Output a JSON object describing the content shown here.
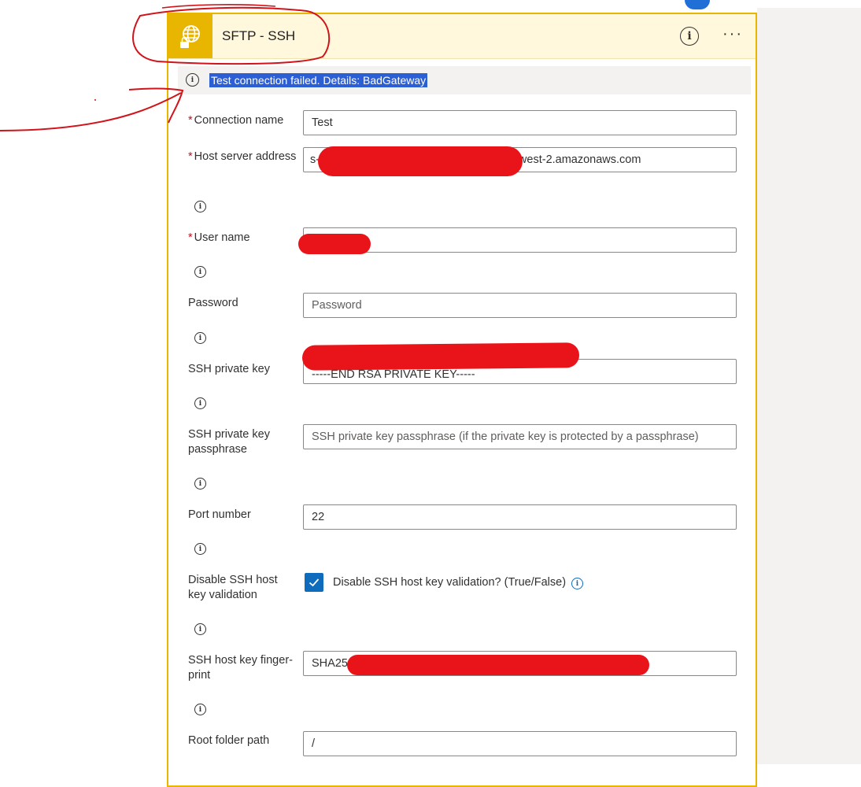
{
  "connector": {
    "title": "SFTP - SSH",
    "icon": "globe-lock-icon",
    "brand_color": "#e8b500"
  },
  "header": {
    "info_icon": "info-icon",
    "more_icon": "more-options-icon"
  },
  "alert": {
    "message": "Test connection failed. Details: BadGateway"
  },
  "form": {
    "connection_name": {
      "label": "Connection name",
      "required": true,
      "value": "Test"
    },
    "host_server_address": {
      "label": "Host server address",
      "required": true,
      "value": "s-",
      "value_suffix": "-west-2.amazonaws.com"
    },
    "user_name": {
      "label": "User name",
      "required": true,
      "value": ""
    },
    "password": {
      "label": "Password",
      "placeholder": "Password"
    },
    "ssh_private_key": {
      "label": "SSH private key",
      "value": "-----END RSA PRIVATE KEY-----"
    },
    "ssh_private_key_passphrase": {
      "label": "SSH private key passphrase",
      "placeholder": "SSH private key passphrase (if the private key is protected by a passphrase)"
    },
    "port_number": {
      "label": "Port number",
      "value": "22"
    },
    "disable_host_key_validation": {
      "label": "Disable SSH host key validation",
      "checkbox_label": "Disable SSH host key validation? (True/False)",
      "checked": true
    },
    "ssh_host_key_fingerprint": {
      "label": "SSH host key finger-print",
      "value": "SHA256"
    },
    "root_folder_path": {
      "label": "Root folder path",
      "value": "/"
    }
  },
  "required_marker": "*",
  "colors": {
    "accent": "#0f6cbd",
    "alert_highlight": "#2c5fd4",
    "redaction": "#e8141a",
    "annotation": "#d0141a"
  }
}
